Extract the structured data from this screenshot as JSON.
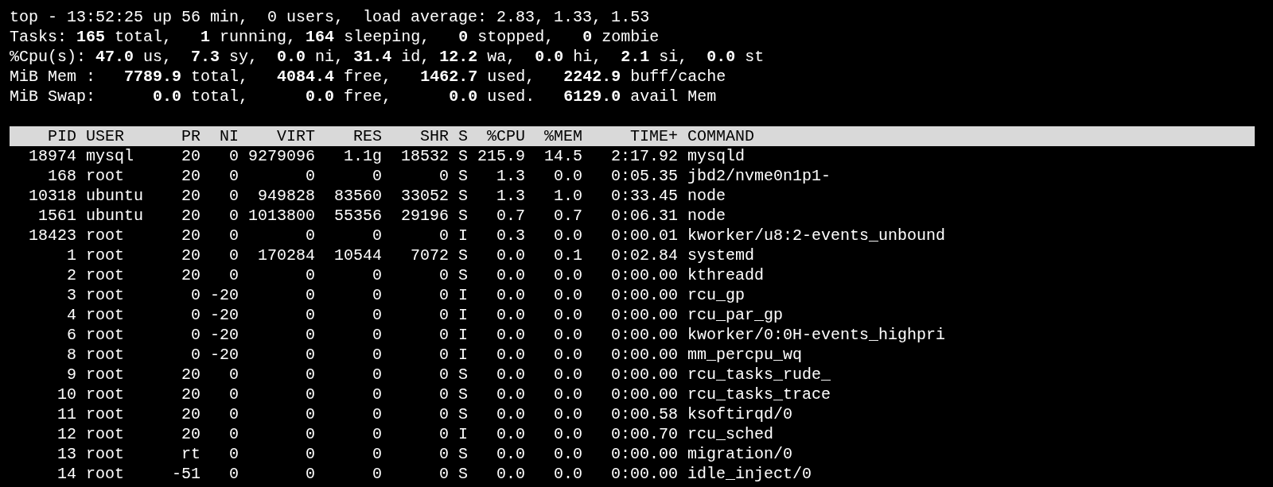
{
  "summary": [
    "top - 13:52:25 up 56 min,  0 users,  load average: 2.83, 1.33, 1.53",
    "Tasks: **165** total,   **1** running, **164** sleeping,   **0** stopped,   **0** zombie",
    "%Cpu(s): **47.0** us,  **7.3** sy,  **0.0** ni, **31.4** id, **12.2** wa,  **0.0** hi,  **2.1** si,  **0.0** st",
    "MiB Mem :   **7789.9** total,   **4084.4** free,   **1462.7** used,   **2242.9** buff/cache",
    "MiB Swap:      **0.0** total,      **0.0** free,      **0.0** used.   **6129.0** avail Mem"
  ],
  "table": {
    "columns": [
      "PID",
      "USER",
      "PR",
      "NI",
      "VIRT",
      "RES",
      "SHR",
      "S",
      "%CPU",
      "%MEM",
      "TIME+",
      "COMMAND"
    ],
    "rows": [
      [
        "18974",
        "mysql",
        "20",
        "0",
        "9279096",
        "1.1g",
        "18532",
        "S",
        "215.9",
        "14.5",
        "2:17.92",
        "mysqld"
      ],
      [
        "168",
        "root",
        "20",
        "0",
        "0",
        "0",
        "0",
        "S",
        "1.3",
        "0.0",
        "0:05.35",
        "jbd2/nvme0n1p1-"
      ],
      [
        "10318",
        "ubuntu",
        "20",
        "0",
        "949828",
        "83560",
        "33052",
        "S",
        "1.3",
        "1.0",
        "0:33.45",
        "node"
      ],
      [
        "1561",
        "ubuntu",
        "20",
        "0",
        "1013800",
        "55356",
        "29196",
        "S",
        "0.7",
        "0.7",
        "0:06.31",
        "node"
      ],
      [
        "18423",
        "root",
        "20",
        "0",
        "0",
        "0",
        "0",
        "I",
        "0.3",
        "0.0",
        "0:00.01",
        "kworker/u8:2-events_unbound"
      ],
      [
        "1",
        "root",
        "20",
        "0",
        "170284",
        "10544",
        "7072",
        "S",
        "0.0",
        "0.1",
        "0:02.84",
        "systemd"
      ],
      [
        "2",
        "root",
        "20",
        "0",
        "0",
        "0",
        "0",
        "S",
        "0.0",
        "0.0",
        "0:00.00",
        "kthreadd"
      ],
      [
        "3",
        "root",
        "0",
        "-20",
        "0",
        "0",
        "0",
        "I",
        "0.0",
        "0.0",
        "0:00.00",
        "rcu_gp"
      ],
      [
        "4",
        "root",
        "0",
        "-20",
        "0",
        "0",
        "0",
        "I",
        "0.0",
        "0.0",
        "0:00.00",
        "rcu_par_gp"
      ],
      [
        "6",
        "root",
        "0",
        "-20",
        "0",
        "0",
        "0",
        "I",
        "0.0",
        "0.0",
        "0:00.00",
        "kworker/0:0H-events_highpri"
      ],
      [
        "8",
        "root",
        "0",
        "-20",
        "0",
        "0",
        "0",
        "I",
        "0.0",
        "0.0",
        "0:00.00",
        "mm_percpu_wq"
      ],
      [
        "9",
        "root",
        "20",
        "0",
        "0",
        "0",
        "0",
        "S",
        "0.0",
        "0.0",
        "0:00.00",
        "rcu_tasks_rude_"
      ],
      [
        "10",
        "root",
        "20",
        "0",
        "0",
        "0",
        "0",
        "S",
        "0.0",
        "0.0",
        "0:00.00",
        "rcu_tasks_trace"
      ],
      [
        "11",
        "root",
        "20",
        "0",
        "0",
        "0",
        "0",
        "S",
        "0.0",
        "0.0",
        "0:00.58",
        "ksoftirqd/0"
      ],
      [
        "12",
        "root",
        "20",
        "0",
        "0",
        "0",
        "0",
        "I",
        "0.0",
        "0.0",
        "0:00.70",
        "rcu_sched"
      ],
      [
        "13",
        "root",
        "rt",
        "0",
        "0",
        "0",
        "0",
        "S",
        "0.0",
        "0.0",
        "0:00.00",
        "migration/0"
      ],
      [
        "14",
        "root",
        "-51",
        "0",
        "0",
        "0",
        "0",
        "S",
        "0.0",
        "0.0",
        "0:00.00",
        "idle_inject/0"
      ]
    ]
  }
}
